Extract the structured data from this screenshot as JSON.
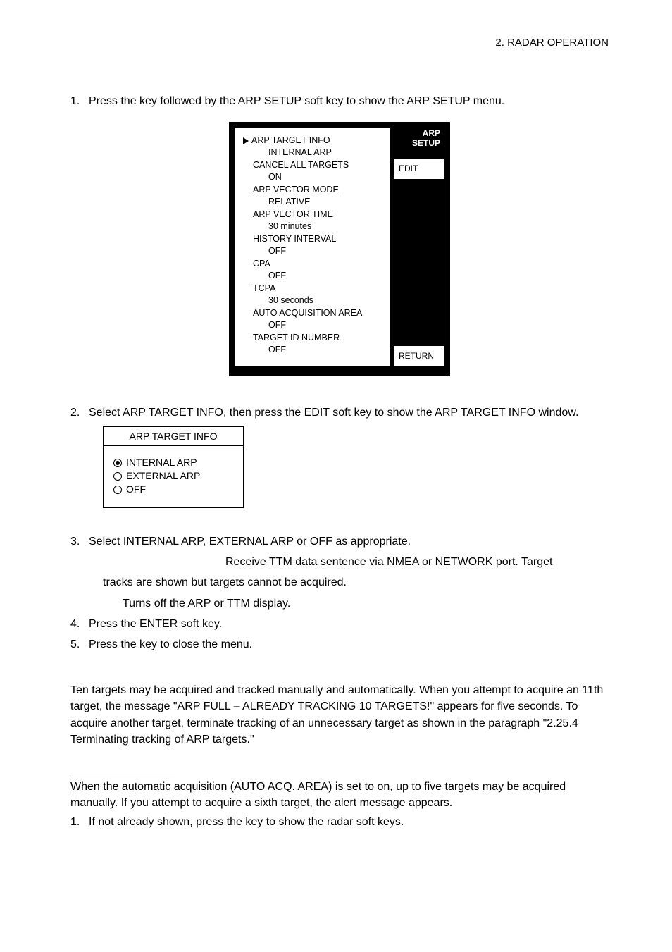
{
  "header": {
    "right_title": "2. RADAR OPERATION"
  },
  "steps": {
    "s1": {
      "num": "1.",
      "text": "Press the         key followed by the ARP SETUP soft key to show the ARP SETUP menu."
    },
    "s2": {
      "num": "2.",
      "text": "Select ARP TARGET INFO, then press the EDIT soft key to show the ARP TARGET INFO window."
    },
    "s3": {
      "num": "3.",
      "text": "Select INTERNAL ARP, EXTERNAL ARP or OFF as appropriate."
    },
    "s3_line2": "Receive TTM data sentence via NMEA or NETWORK port. Target",
    "s3_line3": "tracks are shown but targets cannot be acquired.",
    "s3_line4": "Turns off the ARP or TTM display.",
    "s4": {
      "num": "4.",
      "text": "Press the ENTER soft key."
    },
    "s5": {
      "num": "5.",
      "text": "Press the         key to close the menu."
    }
  },
  "menu": {
    "items": [
      {
        "label": "ARP TARGET INFO",
        "value": "INTERNAL ARP",
        "pointer": true
      },
      {
        "label": "CANCEL ALL TARGETS",
        "value": "ON"
      },
      {
        "label": "ARP VECTOR MODE",
        "value": "RELATIVE"
      },
      {
        "label": "ARP VECTOR TIME",
        "value": "30 minutes"
      },
      {
        "label": "HISTORY INTERVAL",
        "value": "OFF"
      },
      {
        "label": "CPA",
        "value": "OFF"
      },
      {
        "label": "TCPA",
        "value": "30 seconds"
      },
      {
        "label": "AUTO ACQUISITION AREA",
        "value": "OFF"
      },
      {
        "label": "TARGET ID NUMBER",
        "value": "OFF"
      }
    ],
    "tab": {
      "line1": "ARP",
      "line2": "SETUP"
    },
    "btnEdit": "EDIT",
    "btnReturn": "RETURN"
  },
  "infoWindow": {
    "title": "ARP TARGET INFO",
    "opt1": "INTERNAL ARP",
    "opt2": "EXTERNAL ARP",
    "opt3": "OFF"
  },
  "paragraph2": "Ten targets may be acquired and tracked manually and automatically. When you attempt to acquire an 11th target, the message \"ARP FULL – ALREADY TRACKING 10 TARGETS!\" appears for five seconds. To acquire another target, terminate tracking of an unnecessary target as shown in the paragraph \"2.25.4 Terminating tracking of ARP targets.\"",
  "bottom": {
    "p": "When the automatic acquisition (AUTO ACQ. AREA) is set to on, up to five targets may be acquired manually. If you attempt to acquire a sixth target, the alert message appears.",
    "b1num": "1.",
    "b1text": "If not already shown, press the                  key to show the radar soft keys."
  }
}
